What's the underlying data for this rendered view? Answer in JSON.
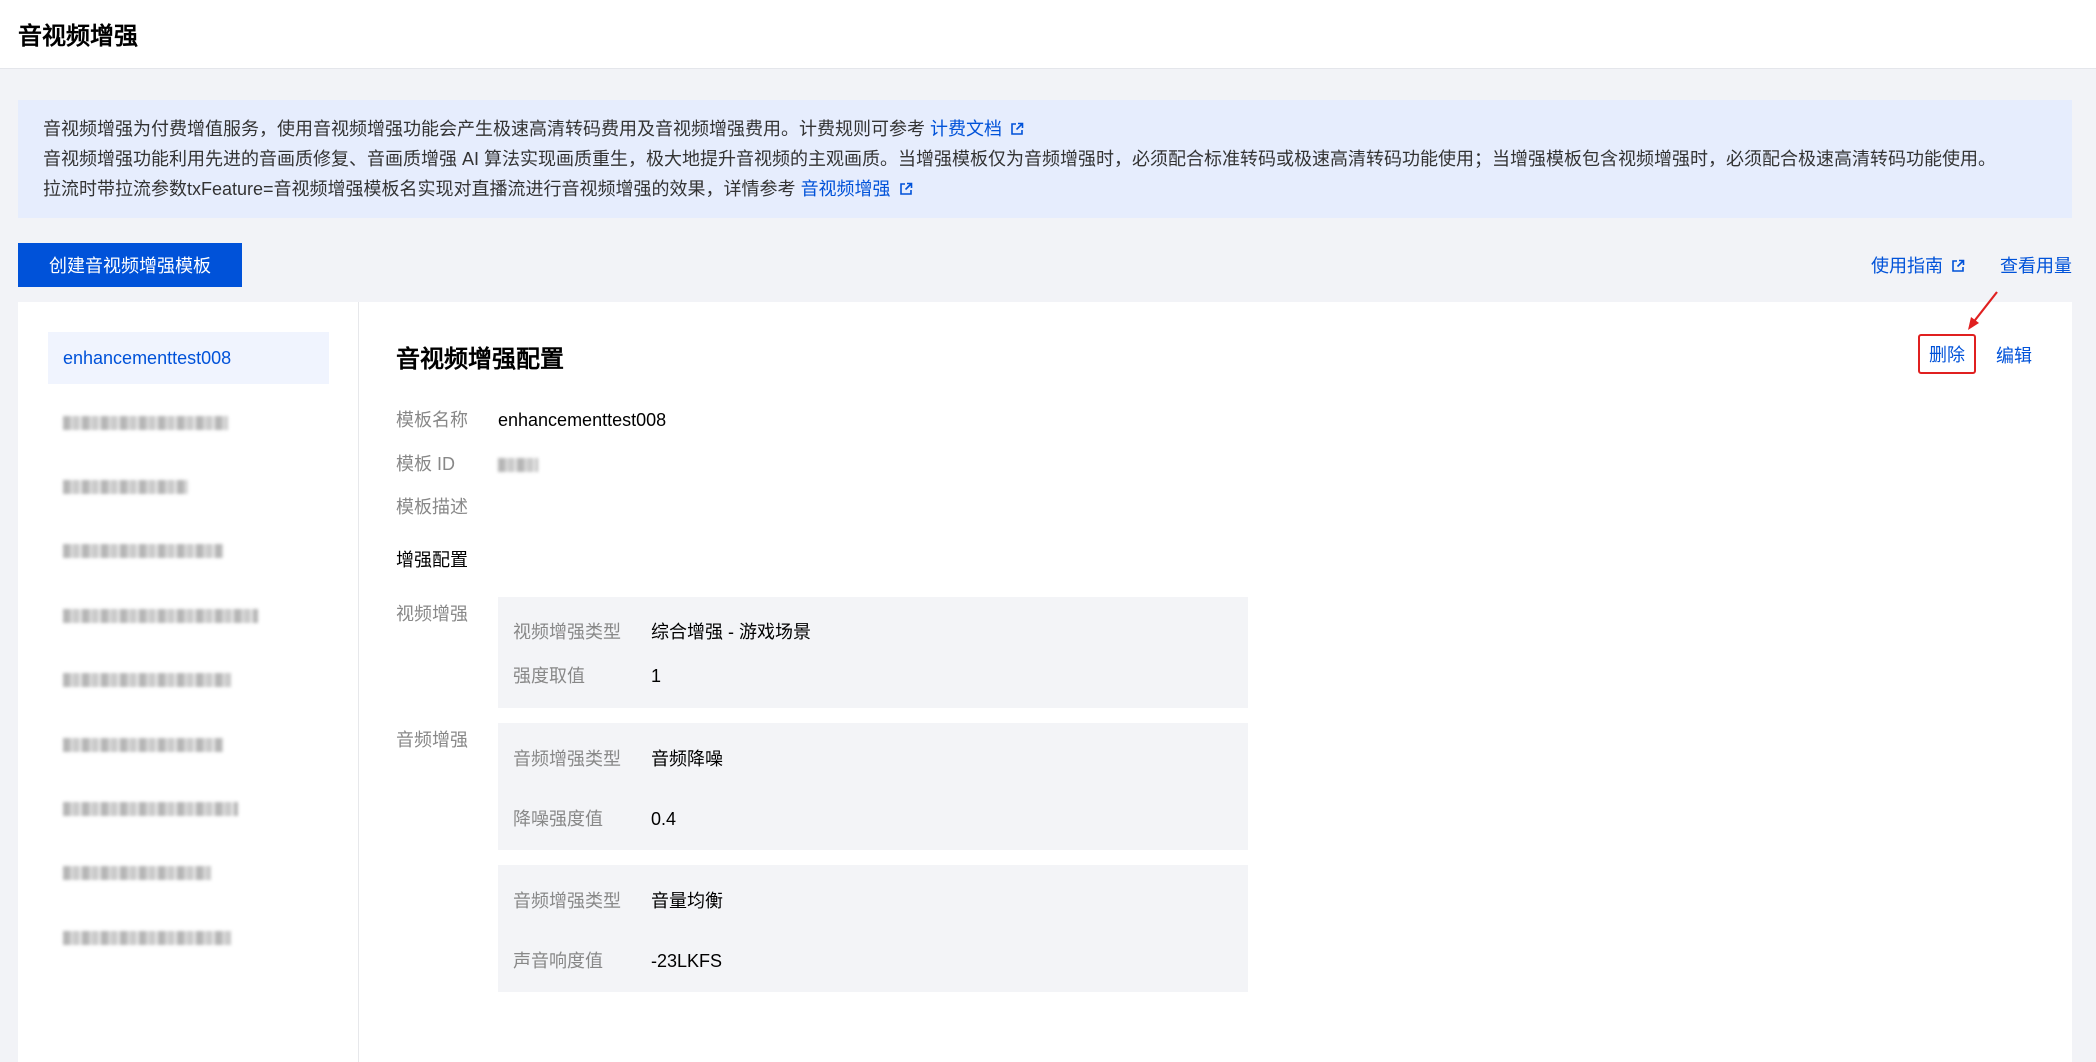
{
  "page_title": "音视频增强",
  "notice": {
    "line1_text": "音视频增强为付费增值服务，使用音视频增强功能会产生极速高清转码费用及音视频增强费用。计费规则可参考",
    "line1_link": "计费文档",
    "line2_text": "音视频增强功能利用先进的音画质修复、音画质增强 AI 算法实现画质重生，极大地提升音视频的主观画质。当增强模板仅为音频增强时，必须配合标准转码或极速高清转码功能使用；当增强模板包含视频增强时，必须配合极速高清转码功能使用。",
    "line3_text": "拉流时带拉流参数txFeature=音视频增强模板名实现对直播流进行音视频增强的效果，详情参考",
    "line3_link": "音视频增强"
  },
  "create_button_label": "创建音视频增强模板",
  "top_links": {
    "guide": "使用指南",
    "usage": "查看用量"
  },
  "sidebar": {
    "items": [
      {
        "label": "enhancementtest008",
        "active": true
      }
    ]
  },
  "detail": {
    "heading": "音视频增强配置",
    "delete_label": "删除",
    "edit_label": "编辑",
    "name_key": "模板名称",
    "name_value": "enhancementtest008",
    "id_key": "模板 ID",
    "desc_key": "模板描述",
    "config_title": "增强配置",
    "video_label": "视频增强",
    "audio_label": "音频增强",
    "video_card": {
      "type_key": "视频增强类型",
      "type_value": "综合增强 - 游戏场景",
      "strength_key": "强度取值",
      "strength_value": "1"
    },
    "audio_card_1": {
      "type_key": "音频增强类型",
      "type_value": "音频降噪",
      "strength_key": "降噪强度值",
      "strength_value": "0.4"
    },
    "audio_card_2": {
      "type_key": "音频增强类型",
      "type_value": "音量均衡",
      "strength_key": "声音响度值",
      "strength_value": "-23LKFS"
    }
  },
  "colors": {
    "primary": "#0052d9",
    "highlight_box": "#e02020",
    "page_bg": "#f2f3f7",
    "notice_bg": "#e6edfd"
  }
}
